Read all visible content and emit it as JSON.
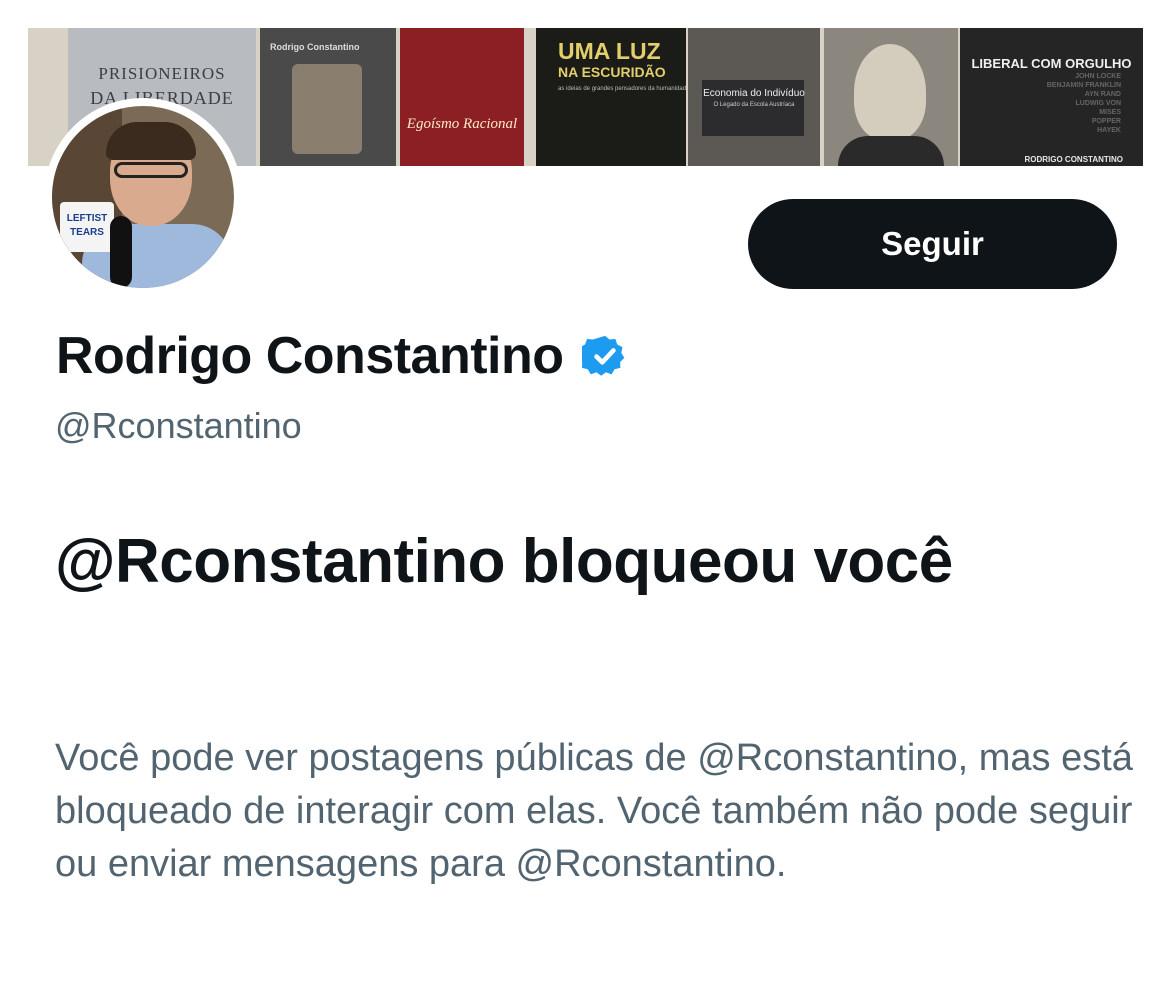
{
  "banner": {
    "books": [
      {
        "title": "PRISIONEIROS",
        "subtitle": "DA LIBERDADE"
      },
      {
        "title": "Rodrigo Constantino"
      },
      {
        "title": "Egoísmo Racional"
      },
      {
        "title": "UMA LUZ",
        "subtitle": "NA ESCURIDÃO",
        "tagline": "as ideias de grandes pensadores da humanidade"
      },
      {
        "title": "Economia do Indivíduo",
        "subtitle": "O Legado da Escola Austríaca"
      },
      {
        "title": "LIBERAL COM ORGULHO",
        "author": "RODRIGO CONSTANTINO",
        "names": [
          "JOHN LOCKE",
          "BENJAMIN FRANKLIN",
          "AYN RAND",
          "LUDWIG VON",
          "MISES",
          "POPPER",
          "HAYEK"
        ]
      }
    ],
    "mug_text": "LEFTIST TEARS"
  },
  "profile": {
    "display_name": "Rodrigo Constantino",
    "handle": "@Rconstantino",
    "verified_color": "#1d9bf0"
  },
  "actions": {
    "follow_label": "Seguir"
  },
  "blocked": {
    "title": "@Rconstantino bloqueou você",
    "description": "Você pode ver postagens públicas de @Rconstantino, mas está bloqueado de interagir com elas. Você também não pode seguir ou enviar mensagens para @Rconstantino."
  }
}
